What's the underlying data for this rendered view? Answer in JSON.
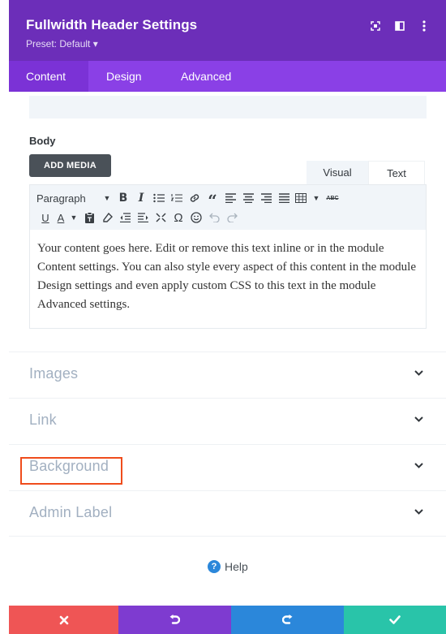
{
  "header": {
    "title": "Fullwidth Header Settings",
    "preset": "Preset: Default ▾",
    "icons": [
      "fullscreen-icon",
      "split-view-icon",
      "more-options-icon"
    ]
  },
  "tabs": [
    {
      "label": "Content",
      "active": true
    },
    {
      "label": "Design",
      "active": false
    },
    {
      "label": "Advanced",
      "active": false
    }
  ],
  "body": {
    "label": "Body",
    "add_media": "ADD MEDIA",
    "visual_tab": "Visual",
    "text_tab": "Text",
    "format_select": "Paragraph",
    "content": "Your content goes here. Edit or remove this text inline or in the module Content settings. You can also style every aspect of this content in the module Design settings and even apply custom CSS to this text in the module Advanced settings."
  },
  "toolbar": {
    "bold": "B",
    "italic": "I",
    "quote": "“",
    "omega": "Ω",
    "underline": "U",
    "text_color": "A",
    "strikethrough_abbr": "ABC"
  },
  "sections": [
    {
      "label": "Images"
    },
    {
      "label": "Link"
    },
    {
      "label": "Background",
      "highlighted": true
    },
    {
      "label": "Admin Label"
    }
  ],
  "help": {
    "label": "Help",
    "icon": "?"
  },
  "bottom_bar": {
    "buttons": [
      "cancel-icon",
      "undo-icon",
      "redo-icon",
      "save-icon"
    ],
    "colors": {
      "cancel": "#ef5555",
      "undo": "#7e3bd0",
      "redo": "#2b87da",
      "save": "#29c4a9"
    }
  },
  "colors": {
    "header_bg": "#6c2eb9",
    "tabs_bg": "#8a40e6",
    "highlight_border": "#ef4c1c"
  }
}
